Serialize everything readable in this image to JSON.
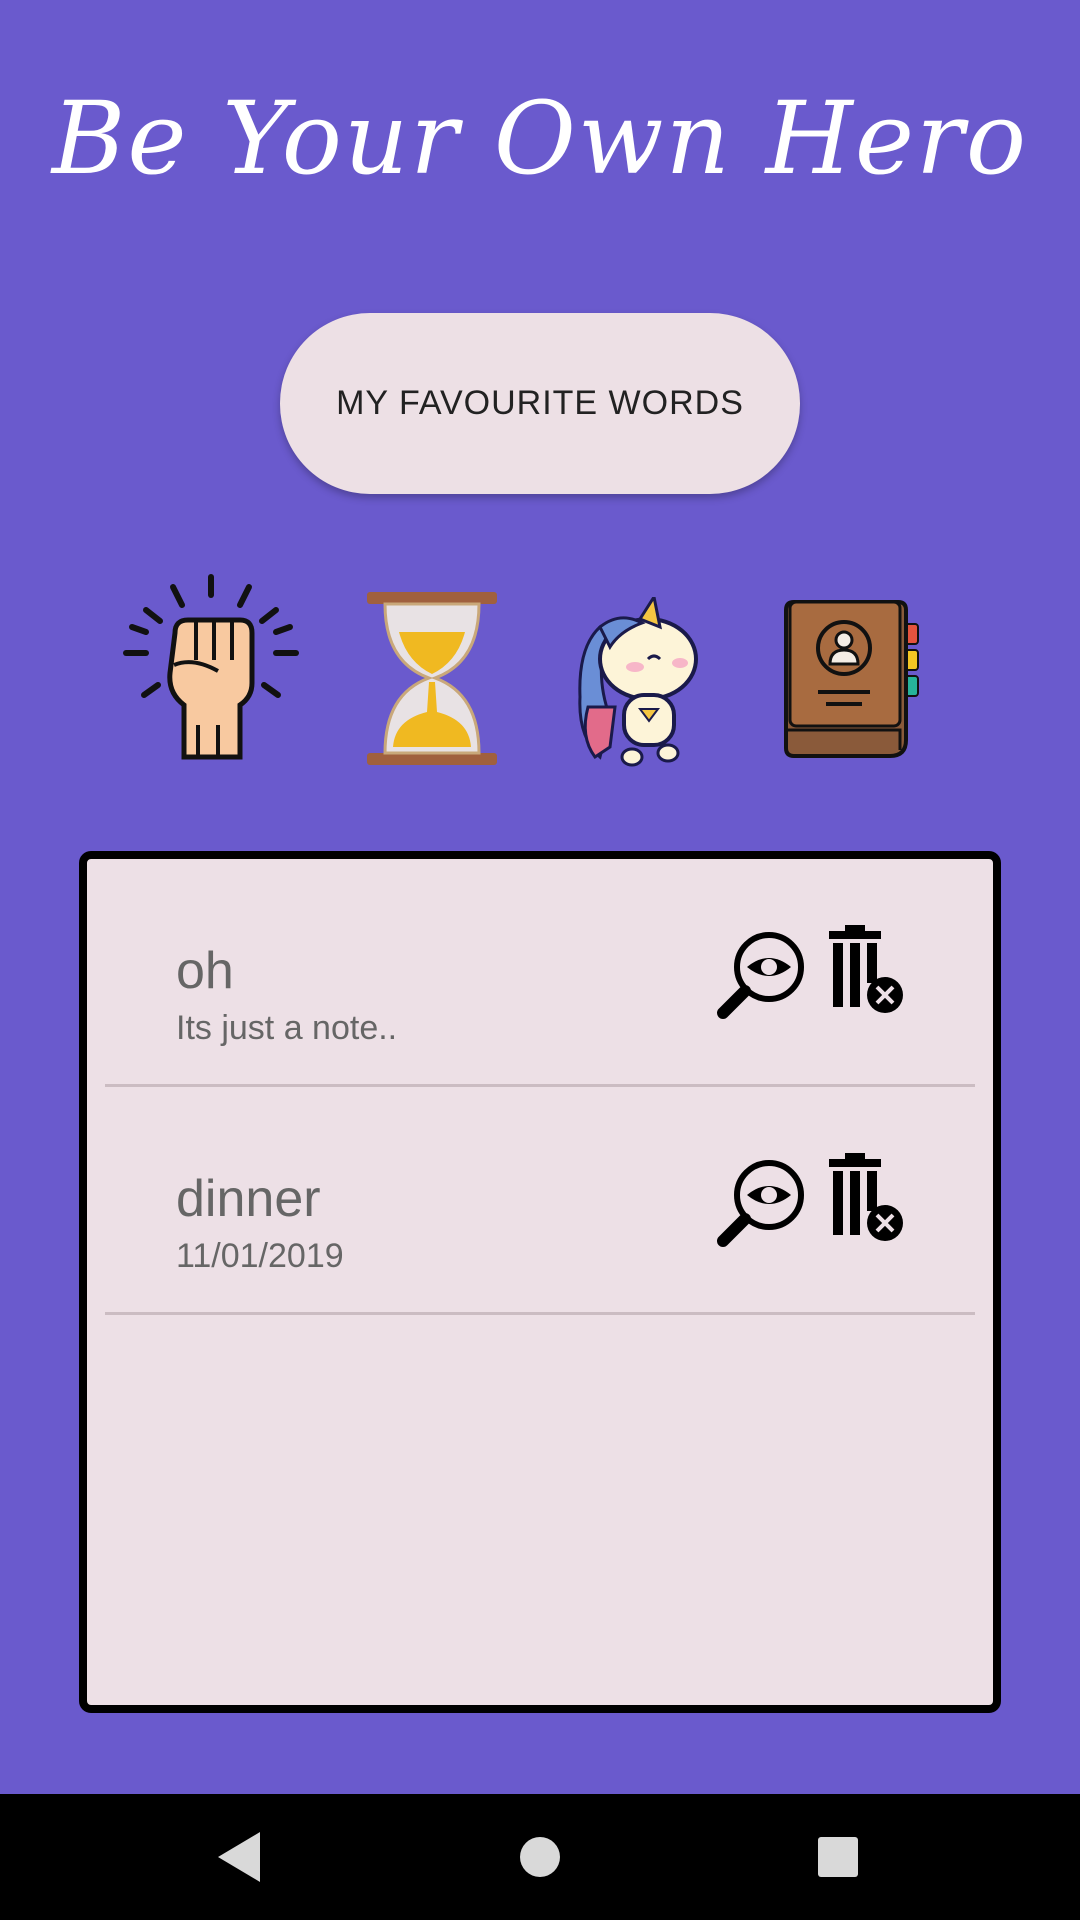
{
  "app": {
    "title": "Be Your Own Hero",
    "favourite_button_label": "MY FAVOURITE WORDS",
    "colors": {
      "background": "#6a5acd",
      "card": "#ede0e6",
      "button": "#ede0e5"
    }
  },
  "feature_icons": [
    "raised-fist-icon",
    "hourglass-icon",
    "unicorn-hero-icon",
    "contacts-book-icon"
  ],
  "notes": [
    {
      "title": "oh",
      "subtitle": "Its just a note.."
    },
    {
      "title": "dinner",
      "subtitle": "11/01/2019"
    }
  ],
  "navbar": {
    "items": [
      "back-icon",
      "home-icon",
      "recents-icon"
    ]
  }
}
